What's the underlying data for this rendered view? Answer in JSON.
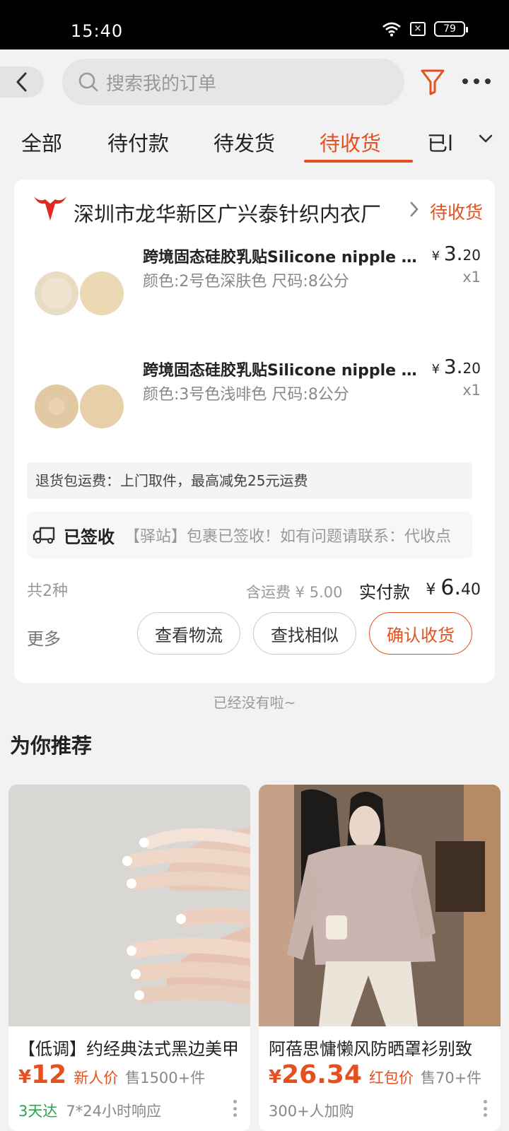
{
  "status_bar": {
    "time": "15:40",
    "battery": "79",
    "sim": "×"
  },
  "search": {
    "placeholder": "搜索我的订单"
  },
  "tabs": [
    {
      "label": "全部"
    },
    {
      "label": "待付款"
    },
    {
      "label": "待发货"
    },
    {
      "label": "待收货"
    },
    {
      "label": "已l"
    }
  ],
  "order": {
    "shop_name": "深圳市龙华新区广兴泰针织内衣厂",
    "status": "待收货",
    "items": [
      {
        "title": "跨境固态硅胶乳贴Silicone nipple cover",
        "sku": "颜色:2号色深肤色 尺码:8公分",
        "price_yuan": "¥",
        "price_int": "3.",
        "price_dec": "20",
        "qty": "x1"
      },
      {
        "title": "跨境固态硅胶乳贴Silicone nipple cover",
        "sku": "颜色:3号色浅啡色 尺码:8公分",
        "price_yuan": "¥",
        "price_int": "3.",
        "price_dec": "20",
        "qty": "x1"
      }
    ],
    "return_text": "退货包运费：上门取件，最高减免25元运费",
    "logistics_status": "已签收",
    "logistics_text": "【驿站】包裹已签收！如有问题请联系：代收点",
    "count_label": "共2种",
    "shipping_text": "含运费 ¥ 5.00",
    "paid_label": "实付款",
    "paid_yuan": "¥ ",
    "paid_int": "6.",
    "paid_dec": "40",
    "more_label": "更多",
    "btn_logistics": "查看物流",
    "btn_similar": "查找相似",
    "btn_confirm": "确认收货"
  },
  "no_more": "已经没有啦~",
  "recommend": {
    "title": "为你推荐",
    "cards": [
      {
        "name": "【低调】约经典法式黑边美甲",
        "yuan": "¥",
        "price": "12",
        "tag": "新人价",
        "sold": "售1500+件",
        "foot_green": "3天达",
        "foot": "7*24小时响应"
      },
      {
        "name": "阿蓓思慵懒风防晒罩衫别致",
        "yuan": "¥",
        "price": "26.34",
        "tag": "红包价",
        "sold": "售70+件",
        "foot_green": "",
        "foot": "300+人加购"
      }
    ]
  },
  "colors": {
    "accent": "#e5511e",
    "green": "#2aa44f",
    "background": "#f2f2f2"
  }
}
